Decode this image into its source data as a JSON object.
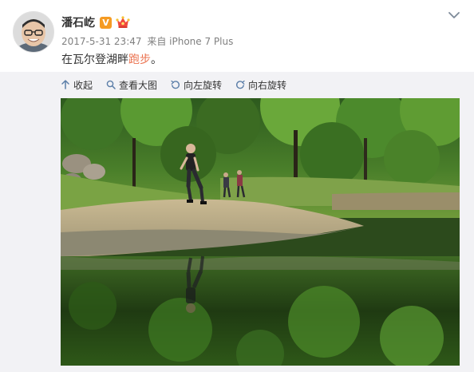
{
  "post": {
    "author": "潘石屹",
    "verified_badge": "V",
    "badge_icons": [
      "verified-v-badge",
      "member-crown-icon"
    ],
    "timestamp": "2017-5-31 23:47",
    "source": "来自 iPhone 7 Plus",
    "text_prefix": "在瓦尔登湖畔",
    "text_keyword": "跑步",
    "text_suffix": "。"
  },
  "toolbar": {
    "collapse": "收起",
    "view_large": "查看大图",
    "rotate_left": "向左旋转",
    "rotate_right": "向右旋转"
  },
  "colors": {
    "keyword": "#eb7350",
    "verified_badge": "#f59b23",
    "panel_background": "#f2f2f5",
    "icon_blue": "#5b7ea8"
  },
  "media": {
    "image": "photo of a man running along the lake shore with forest reflected in the water"
  }
}
